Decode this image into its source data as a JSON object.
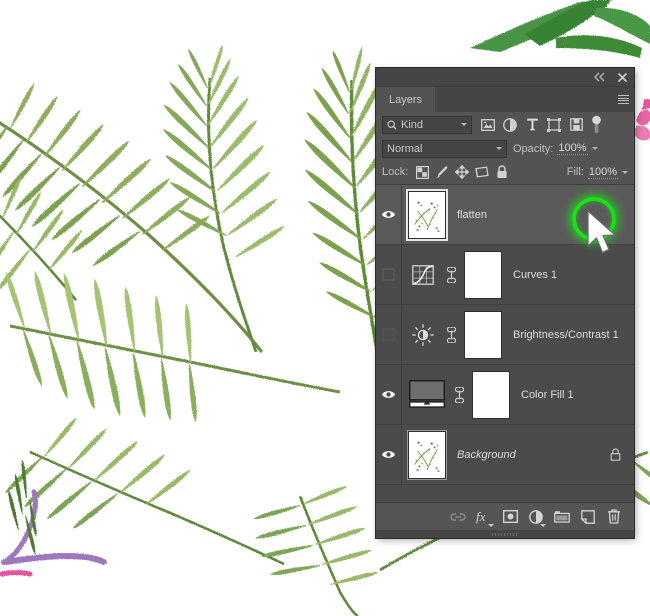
{
  "panel": {
    "title_tab": "Layers",
    "titlebar_icons": [
      {
        "name": "collapse-icon",
        "glyph": "<<"
      },
      {
        "name": "close-icon",
        "glyph": "X"
      }
    ],
    "menu_icon": "panel-menu-icon",
    "filter": {
      "kind_label": "Kind",
      "search_icon": "search-icon",
      "type_filters": [
        {
          "name": "filter-pixel-layers-icon",
          "title": "Pixel layers"
        },
        {
          "name": "filter-adjustment-layers-icon",
          "title": "Adjustment layers"
        },
        {
          "name": "filter-type-layers-icon",
          "title": "Type layers"
        },
        {
          "name": "filter-shape-layers-icon",
          "title": "Shape layers"
        },
        {
          "name": "filter-smart-objects-icon",
          "title": "Smart objects"
        }
      ],
      "toggle_name": "filter-toggle-switch"
    },
    "blend": {
      "mode": "Normal",
      "opacity_label": "Opacity:",
      "opacity_value": "100%"
    },
    "lock": {
      "label": "Lock:",
      "buttons": [
        {
          "name": "lock-transparent-pixels-icon"
        },
        {
          "name": "lock-image-pixels-icon"
        },
        {
          "name": "lock-position-icon"
        },
        {
          "name": "lock-artboard-nesting-icon"
        },
        {
          "name": "lock-all-icon"
        }
      ],
      "fill_label": "Fill:",
      "fill_value": "100%"
    },
    "layers": [
      {
        "name": "flatten",
        "visible": true,
        "selected": true,
        "type": "pixel",
        "italic": false,
        "locked": false,
        "has_mask": false,
        "has_link": false
      },
      {
        "name": "Curves 1",
        "visible": false,
        "selected": false,
        "type": "curves",
        "italic": false,
        "locked": false,
        "has_mask": true,
        "has_link": true
      },
      {
        "name": "Brightness/Contrast 1",
        "visible": false,
        "selected": false,
        "type": "brightness-contrast",
        "italic": false,
        "locked": false,
        "has_mask": true,
        "has_link": true
      },
      {
        "name": "Color Fill 1",
        "visible": true,
        "selected": false,
        "type": "gradient-fill",
        "italic": false,
        "locked": false,
        "has_mask": true,
        "has_link": true
      },
      {
        "name": "Background",
        "visible": true,
        "selected": false,
        "type": "pixel",
        "italic": true,
        "locked": true,
        "has_mask": false,
        "has_link": false
      }
    ],
    "footer_buttons": [
      {
        "name": "link-layers-button",
        "label": "link"
      },
      {
        "name": "layer-style-fx-button",
        "label": "fx"
      },
      {
        "name": "add-layer-mask-button",
        "label": "mask"
      },
      {
        "name": "new-adjustment-layer-button",
        "label": "adjustment"
      },
      {
        "name": "new-group-button",
        "label": "group"
      },
      {
        "name": "new-layer-button",
        "label": "new-layer"
      },
      {
        "name": "delete-layer-button",
        "label": "delete"
      }
    ]
  },
  "canvas": {
    "artwork_name": "watercolor-fern-illustration",
    "colors": {
      "leaf_light": "#a8bf72",
      "leaf_mid": "#8fae5d",
      "leaf_dark": "#6d8f44",
      "leaf_deep": "#4e7a33",
      "stem_purple": "#9f77bb",
      "accent_pink": "#e2559c",
      "paper": "#ffffff"
    }
  },
  "cursor": {
    "name": "mouse-pointer",
    "highlight_name": "click-highlight-ring",
    "highlight_color": "#17e017"
  }
}
